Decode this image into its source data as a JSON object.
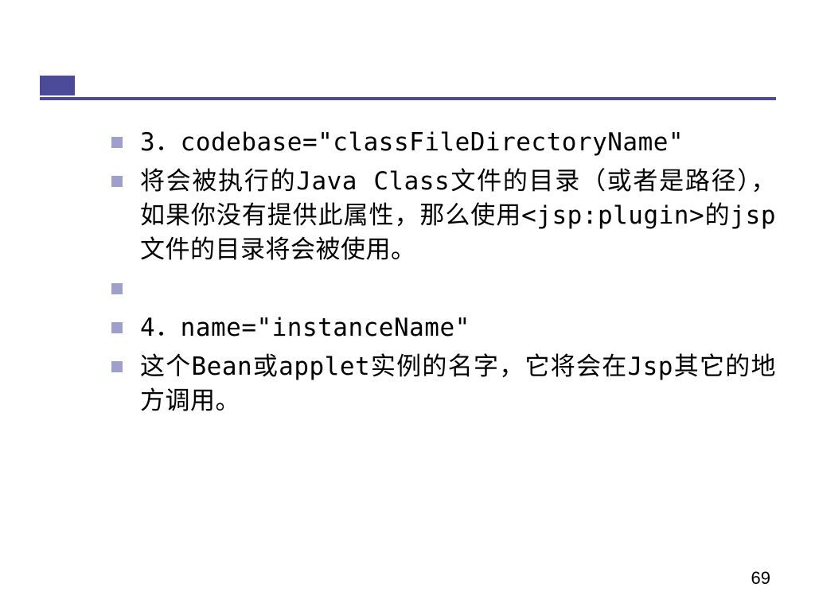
{
  "bullets": [
    {
      "text": "3．codebase=\"classFileDirectoryName\""
    },
    {
      "text": "将会被执行的Java Class文件的目录（或者是路径），如果你没有提供此属性，那么使用<jsp:plugin>的jsp文件的目录将会被使用。"
    },
    {
      "text": ""
    },
    {
      "text": "4．name=\"instanceName\""
    },
    {
      "text": "这个Bean或applet实例的名字，它将会在Jsp其它的地方调用。"
    }
  ],
  "page_number": "69"
}
